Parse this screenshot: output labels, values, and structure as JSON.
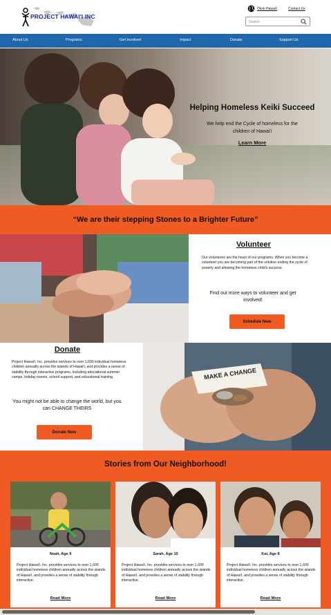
{
  "header": {
    "logo_text": "PROJECT HAWAI'I INC",
    "language_link": "Ōlelo Hawaiʻi",
    "contact_link": "Contact Us",
    "search_placeholder": "Search",
    "logo_color": "#1a2a9c"
  },
  "nav": {
    "items": [
      "About Us",
      "Programs",
      "Get Involved",
      "Impact",
      "Donate",
      "Support Us"
    ],
    "background": "#1f67ad"
  },
  "hero": {
    "title": "Helping Homeless Keiki Succeed",
    "subtitle": "We help end the Cycle of homeless for the children of Hawai'i",
    "link": "Learn More"
  },
  "quote": {
    "text": "“We are their stepping Stones to a Brighter Future”",
    "background": "#ef5b22"
  },
  "volunteer": {
    "title": "Volunteer",
    "body": "Our volunteers are the heart of our programs. When you become a volunteer you are becoming part of the solution ending the cycle of poverty and allowing the homeless child's success.",
    "cta": "Find out more ways to volunteer and get involved!",
    "button": "Schedule Now"
  },
  "donate": {
    "title": "Donate",
    "body": "Project Hawai'i, Inc. provides services to over 1,600 individual homeless children annually across the islands of Hawai'i, and provides a sense of stability through interactive programs, including educational summer camps, holiday events, school support, and educational training.",
    "cta": "You might not be able to change the world, but you can CHANGE THEIRS",
    "button": "Donate Now",
    "sign_text": "MAKE A CHANGE"
  },
  "stories": {
    "title": "Stories from Our Neighborhood!",
    "cards": [
      {
        "name": "Noah, Age 9",
        "body": "Project Hawai'i, Inc. provides services to over 1,600 individual homeless children annually across the islands of Hawai'i, and provides a sense of stability through interactive.",
        "link": "Read More"
      },
      {
        "name": "Sarah, Age 10",
        "body": "Project Hawai'i, Inc. provides services to over 1,600 individual homeless children annually across the islands of Hawai'i, and provides a sense of stability through interactive.",
        "link": "Read More"
      },
      {
        "name": "Kai, Age 8",
        "body": "Project Hawai'i, Inc. provides services to over 1,600 individual homeless children annually across the islands of Hawai'i, and provides a sense of stability through interactive.",
        "link": "Read More"
      }
    ]
  },
  "icons": {
    "language": "globe-icon",
    "search": "search-icon"
  }
}
